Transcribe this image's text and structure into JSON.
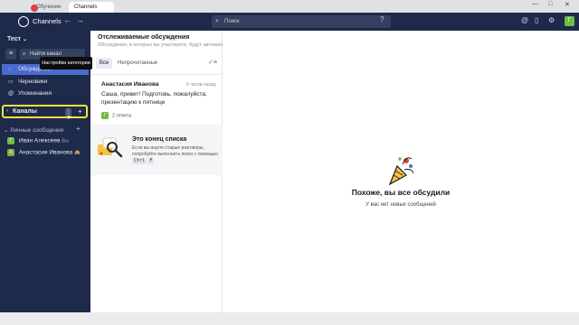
{
  "browser": {
    "tabs": [
      {
        "label": "Обучение",
        "badge": "2"
      },
      {
        "label": "Channels"
      }
    ],
    "window_controls": [
      "—",
      "□",
      "✕"
    ]
  },
  "topbar": {
    "app_title": "Channels",
    "back_icon": "←",
    "forward_icon": "→",
    "search_placeholder": "Поиск",
    "help_icon": "?",
    "icons": [
      "@",
      "bookmark-icon",
      "flag-icon",
      "gear-icon"
    ],
    "user_initial": "Г"
  },
  "sidebar": {
    "workspace": "Тест",
    "find_channel": "Найти канал",
    "items": [
      {
        "label": "Обсуждения",
        "icon": "threads-icon"
      },
      {
        "label": "Черновики",
        "icon": "draft-icon"
      },
      {
        "label": "Упоминания",
        "icon": "mention-icon"
      }
    ],
    "tooltip": "Настройки категории",
    "channels_label": "Каналы",
    "dm_header": "Личные сообщения",
    "dms": [
      {
        "name": "Иван Алексеев",
        "status": "Вы",
        "initial": "Г",
        "color": "#6ebd45"
      },
      {
        "name": "Анастасия Иванова",
        "status": "🙈",
        "initial": "А",
        "color": "#7cb342"
      }
    ]
  },
  "threads": {
    "title": "Отслеживаемые обсуждения",
    "subtitle": "Обсуждения, в которых вы участвуете, будут автоматически показываться здесь",
    "filters": {
      "all": "Все",
      "unread": "Непрочитанные"
    },
    "message": {
      "author": "Анастасия Иванова",
      "time": "6 часов назад",
      "text": "Саша, привет! Подготовь, пожалуйста, презентацию к пятнице",
      "replies": "2 ответа",
      "reply_initial": "Г"
    },
    "end": {
      "title": "Это конец списка",
      "text": "Если вы ищете старые разговоры, попробуйте выполнить поиск с помощью",
      "key1": "Ctrl",
      "key2": "F"
    }
  },
  "main": {
    "empty_title": "Похоже, вы все обсудили",
    "empty_sub": "У вас нет новых сообщений"
  },
  "colors": {
    "sidebar_bg": "#1e2a4a",
    "active_item": "#4a6ad0",
    "highlight": "#f4e236",
    "avatar_green": "#6ebd45"
  }
}
